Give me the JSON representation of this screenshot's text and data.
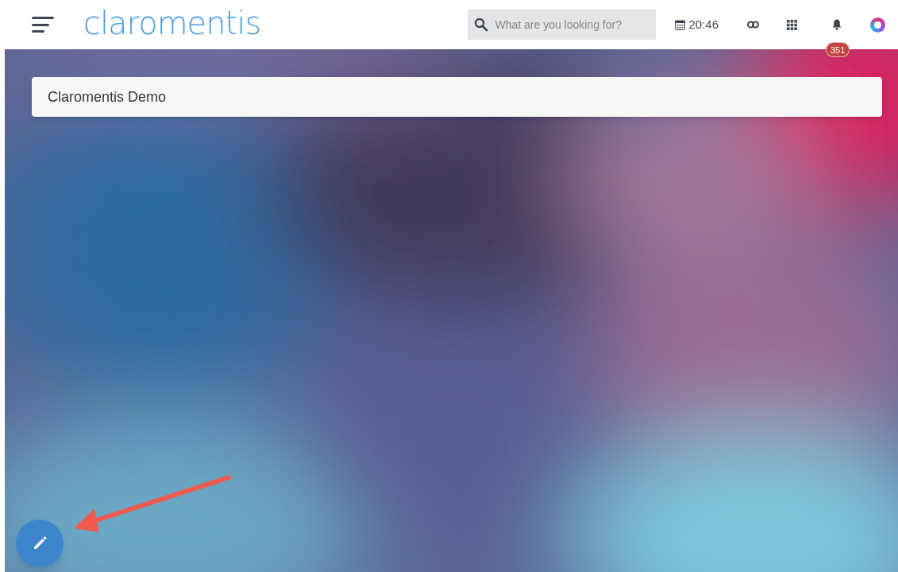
{
  "header": {
    "logo": "claromentis",
    "search": {
      "placeholder": "What are you looking for?"
    },
    "clock": "20:46",
    "notifications": {
      "count": "351"
    }
  },
  "page_title": "Claromentis Demo",
  "annotation": {
    "kind": "arrow"
  }
}
